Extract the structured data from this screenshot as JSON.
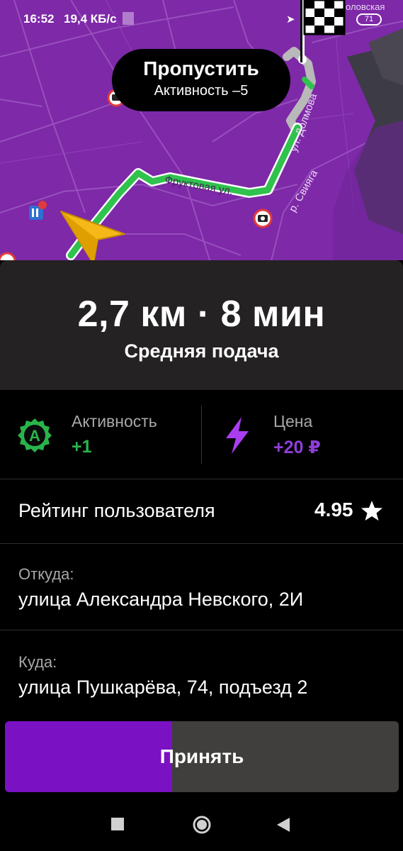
{
  "status_bar": {
    "time": "16:52",
    "speed": "19,4 КБ/с",
    "battery": "71"
  },
  "map": {
    "street_fruit": "Фруктовая ул.",
    "street_dolmova": "ул. Долмова",
    "street_svyaga": "р. Свияга",
    "street_top": "оловская"
  },
  "skip_pill": {
    "title": "Пропустить",
    "subtitle": "Активность –5"
  },
  "trip": {
    "distance_time": "2,7 км · 8 мин",
    "pickup_type": "Средняя подача"
  },
  "activity": {
    "badge": "A",
    "label": "Активность",
    "value": "+1"
  },
  "price": {
    "label": "Цена",
    "value": "+20 ₽"
  },
  "rating": {
    "label": "Рейтинг пользователя",
    "value": "4.95"
  },
  "from": {
    "label": "Откуда:",
    "address": "улица Александра Невского, 2И"
  },
  "to": {
    "label": "Куда:",
    "address": "улица Пушкарёва, 74, подъезд 2"
  },
  "accept": {
    "label": "Принять",
    "progress": 0.425
  },
  "colors": {
    "accent": "#7a12c4",
    "activity": "#29b44a",
    "price": "#8e3fd6",
    "map": "#7e29a8"
  },
  "icons": [
    "finish-flag-icon",
    "speed-camera-icon",
    "navigation-arrow-icon",
    "activity-badge-icon",
    "lightning-icon",
    "star-icon",
    "recents-icon",
    "home-icon",
    "back-icon"
  ]
}
